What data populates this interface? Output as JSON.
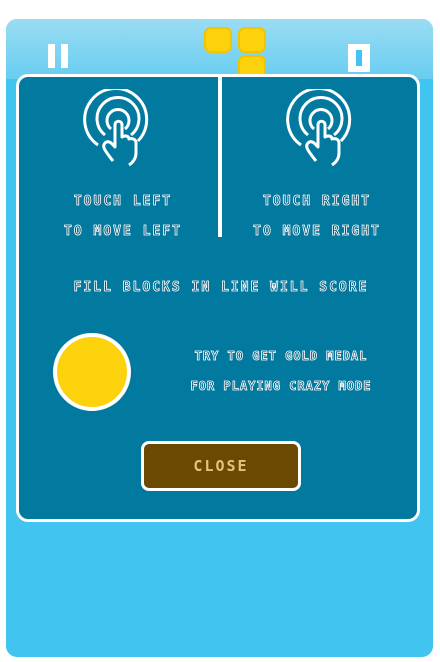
{
  "tutorial": {
    "left_instruction": [
      "Touch left",
      "to move left"
    ],
    "right_instruction": [
      "Touch right",
      "to move right"
    ],
    "fill_line_text": "Fill blocks in line will score",
    "medal_text": [
      "Try to get gold medal",
      "for playing crazy mode"
    ],
    "close_label": "CLOSE"
  },
  "colors": {
    "background": "#41c4ef",
    "panel": "#027a9f",
    "block": "#fcd20c",
    "medal": "#fcd20c",
    "close_button": "#6a4a02"
  },
  "icons": [
    "pause-icon",
    "touch-icon",
    "gold-medal-icon"
  ]
}
